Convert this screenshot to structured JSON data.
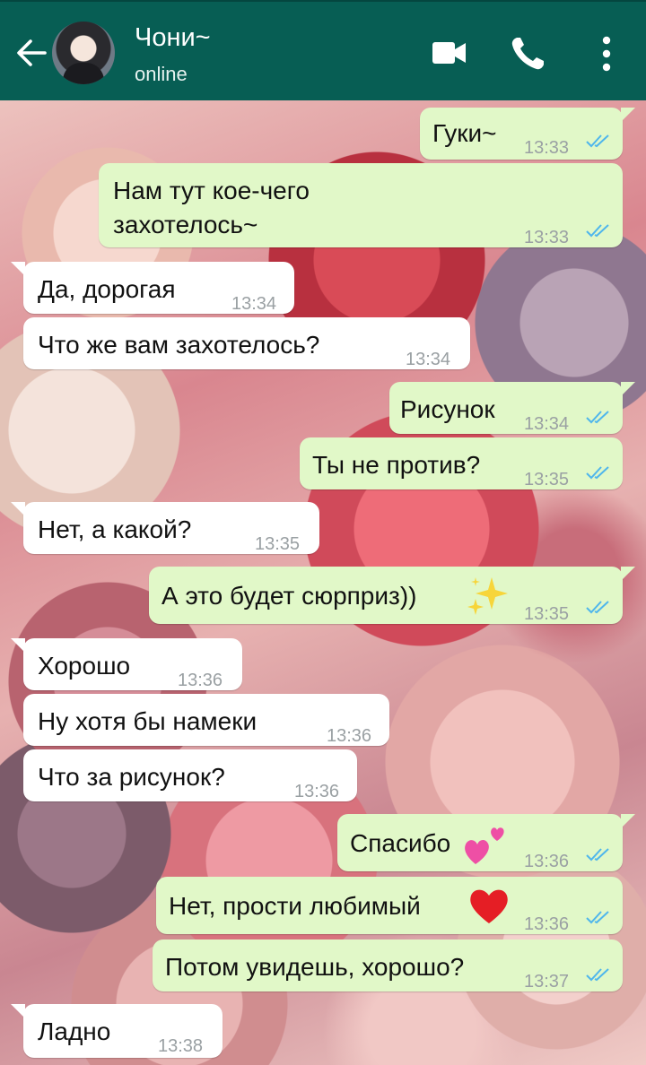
{
  "contact": {
    "name": "Чони~",
    "status": "online"
  },
  "messages": [
    {
      "dir": "out",
      "text": "Гуки~",
      "time": "13:33"
    },
    {
      "dir": "out",
      "text_line1": "Нам тут кое-чего",
      "text_line2": "захотелось~",
      "time": "13:33"
    },
    {
      "dir": "in",
      "text": "Да, дорогая",
      "time": "13:34"
    },
    {
      "dir": "in",
      "text": "Что же вам захотелось?",
      "time": "13:34"
    },
    {
      "dir": "out",
      "text": "Рисунок",
      "time": "13:34"
    },
    {
      "dir": "out",
      "text": "Ты не против?",
      "time": "13:35"
    },
    {
      "dir": "in",
      "text": "Нет, а какой?",
      "time": "13:35"
    },
    {
      "dir": "out",
      "text": "А это будет сюрприз))",
      "time": "13:35",
      "emoji": "sparkles-emoji"
    },
    {
      "dir": "in",
      "text": "Хорошо",
      "time": "13:36"
    },
    {
      "dir": "in",
      "text": "Ну хотя бы намеки",
      "time": "13:36"
    },
    {
      "dir": "in",
      "text": "Что за рисунок?",
      "time": "13:36"
    },
    {
      "dir": "out",
      "text": "Спасибо",
      "time": "13:36",
      "emoji": "two-hearts-emoji"
    },
    {
      "dir": "out",
      "text": "Нет, прости любимый",
      "time": "13:36",
      "emoji": "red-heart-emoji"
    },
    {
      "dir": "out",
      "text": "Потом увидешь, хорошо?",
      "time": "13:37"
    },
    {
      "dir": "in",
      "text": "Ладно",
      "time": "13:38"
    }
  ],
  "colors": {
    "header": "#075e54",
    "incoming_bubble": "#ffffff",
    "outgoing_bubble": "#e1f8c8",
    "read_ticks": "#4fb6ec"
  },
  "icons": [
    "back-arrow-icon",
    "video-call-icon",
    "phone-icon",
    "more-menu-icon",
    "double-check-icon"
  ]
}
